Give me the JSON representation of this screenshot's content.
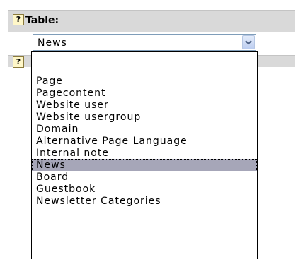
{
  "field": {
    "label": "Table:",
    "help_icon": "?"
  },
  "select": {
    "value": "News"
  },
  "second_row": {
    "help_icon": "?"
  },
  "dropdown": {
    "options": [
      "",
      "Page",
      "Pagecontent",
      "Website user",
      "Website usergroup",
      "Domain",
      "Alternative Page Language",
      "Internal note",
      "News",
      "Board",
      "Guestbook",
      "Newsletter Categories"
    ],
    "selected": "News"
  },
  "colors": {
    "row_bg": "#d9d9d9",
    "selected_bg": "#a6a6b8",
    "select_border": "#7f9db9"
  }
}
